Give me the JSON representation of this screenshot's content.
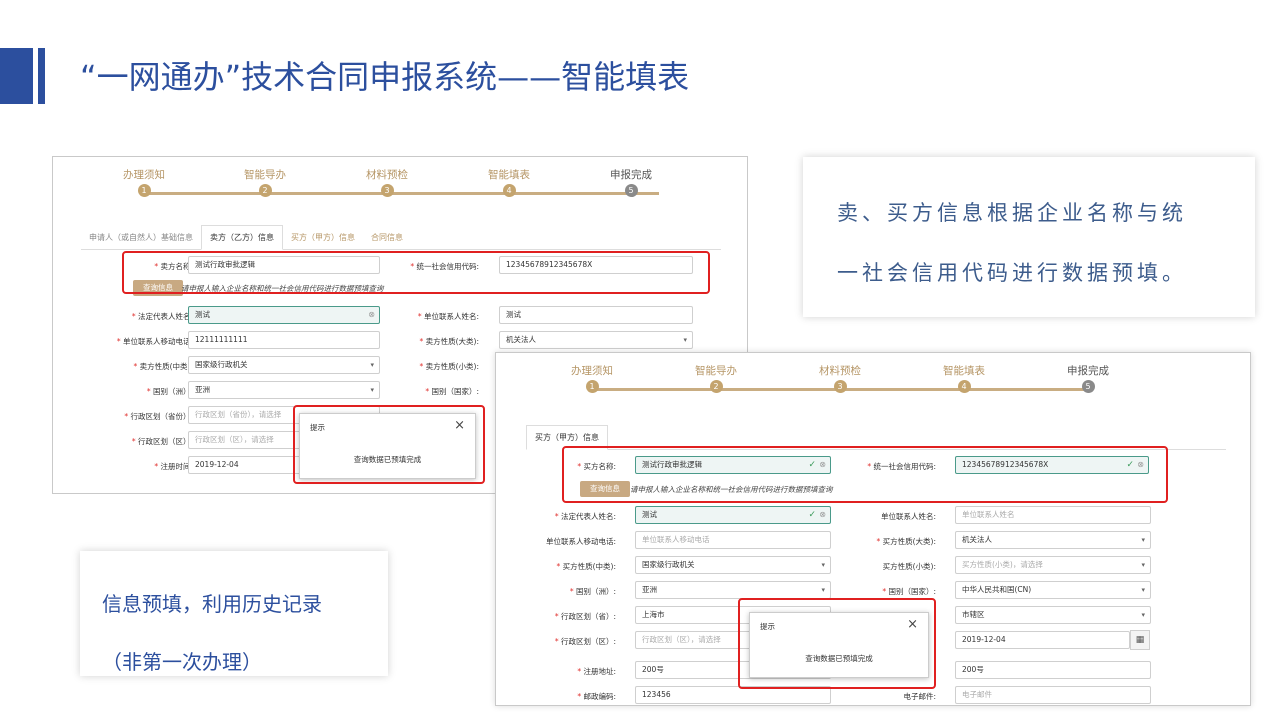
{
  "slide": {
    "title": "“一网通办”技术合同申报系统——智能填表",
    "accent_color": "#2c4f9e"
  },
  "steps": [
    {
      "label": "办理须知",
      "num": "1"
    },
    {
      "label": "智能导办",
      "num": "2"
    },
    {
      "label": "材料预检",
      "num": "3"
    },
    {
      "label": "智能填表",
      "num": "4"
    },
    {
      "label": "申报完成",
      "num": "5"
    }
  ],
  "screenshot_a": {
    "tabs": [
      "申请人（或自然人）基础信息",
      "卖方（乙方）信息",
      "买方（甲方）信息",
      "合同信息"
    ],
    "seller_name_label": "卖方名称:",
    "seller_name_value": "测试行政审批逻辑",
    "credit_code_label": "统一社会信用代码:",
    "credit_code_value": "12345678912345678X",
    "query_button": "查询信息",
    "query_hint": "请申报人输入企业名称和统一社会信用代码进行数据预填查询",
    "legal_rep_label": "法定代表人姓名:",
    "legal_rep_value": "测试",
    "contact_name_label": "单位联系人姓名:",
    "contact_name_value": "测试",
    "contact_phone_label": "单位联系人移动电话:",
    "contact_phone_value": "12111111111",
    "nature_big_label": "卖方性质(大类):",
    "nature_big_value": "机关法人",
    "nature_mid_label": "卖方性质(中类):",
    "nature_mid_value": "国家级行政机关",
    "nature_small_label": "卖方性质(小类):",
    "continent_label": "国别（洲）:",
    "continent_value": "亚洲",
    "country_label": "国别（国家）:",
    "province_label": "行政区划（省份）:",
    "province_placeholder": "行政区划（省份），请选择",
    "district_label": "行政区划（区）:",
    "district_placeholder": "行政区划（区），请选择",
    "reg_time_label": "注册时间:",
    "reg_time_value": "2019-12-04",
    "dialog_title": "提示",
    "dialog_message": "查询数据已预填完成"
  },
  "screenshot_b": {
    "tab": "买方（甲方）信息",
    "buyer_name_label": "买方名称:",
    "buyer_name_value": "测试行政审批逻辑",
    "credit_code_label": "统一社会信用代码:",
    "credit_code_value": "12345678912345678X",
    "query_button": "查询信息",
    "query_hint": "请申报人输入企业名称和统一社会信用代码进行数据预填查询",
    "legal_rep_label": "法定代表人姓名:",
    "legal_rep_value": "测试",
    "contact_name_label": "单位联系人姓名:",
    "contact_name_placeholder": "单位联系人姓名",
    "contact_phone_label": "单位联系人移动电话:",
    "contact_phone_placeholder": "单位联系人移动电话",
    "nature_big_label": "买方性质(大类):",
    "nature_big_value": "机关法人",
    "nature_mid_label": "买方性质(中类):",
    "nature_mid_value": "国家级行政机关",
    "nature_small_label": "买方性质(小类):",
    "nature_small_placeholder": "买方性质(小类)，请选择",
    "continent_label": "国别（洲）:",
    "continent_value": "亚洲",
    "country_label": "国别（国家）:",
    "country_value": "中华人民共和国(CN)",
    "province_label": "行政区划（省）:",
    "province_value": "上海市",
    "district_label": "行政区划（区）:",
    "district_placeholder": "行政区划（区），请选择",
    "district_value": "市辖区",
    "reg_time_value": "2019-12-04",
    "address_label": "注册地址:",
    "address_value": "200号",
    "address_value_right": "200号",
    "postcode_label": "邮政编码:",
    "postcode_value": "123456",
    "email_label": "电子邮件:",
    "email_placeholder": "电子邮件",
    "dialog_title": "提示",
    "dialog_message": "查询数据已预填完成"
  },
  "callouts": {
    "prefill_line1": "卖、买方信息根据企业名称与统",
    "prefill_line2": "一社会信用代码进行数据预填。",
    "history_line1": "信息预填，利用历史记录",
    "history_line2": "（非第一次办理）"
  }
}
